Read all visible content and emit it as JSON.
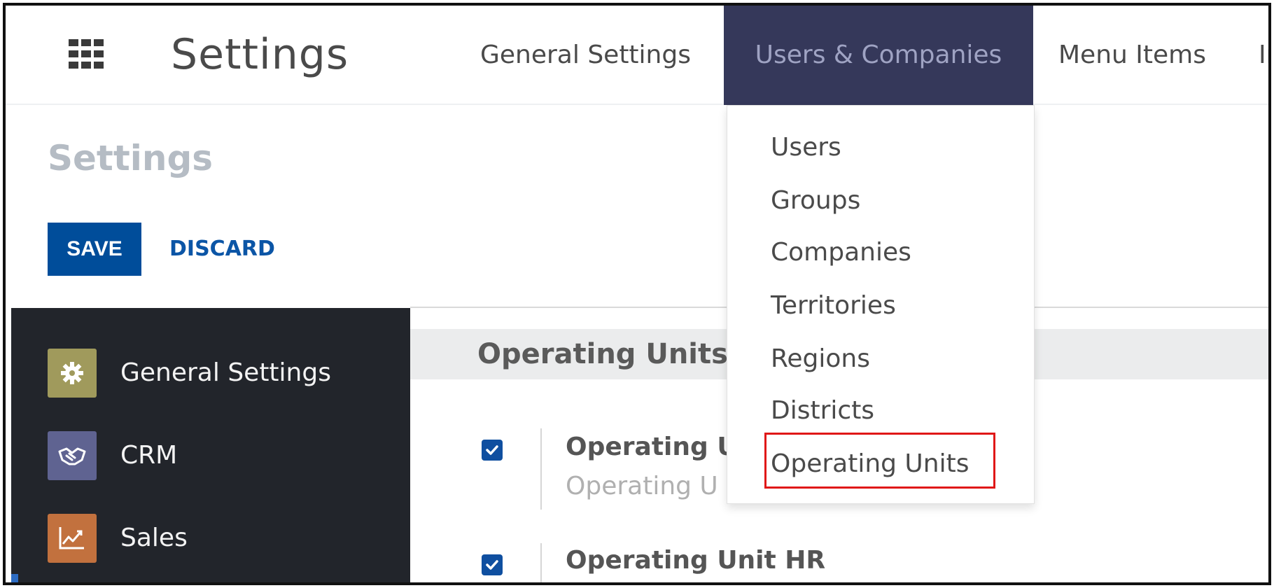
{
  "navbar": {
    "apps_icon": "grid-icon",
    "brand": "Settings",
    "tabs": [
      {
        "label": "General Settings",
        "active": false
      },
      {
        "label": "Users & Companies",
        "active": true
      },
      {
        "label": "Menu Items",
        "active": false
      },
      {
        "label": "In",
        "active": false
      }
    ]
  },
  "control_panel": {
    "title": "Settings",
    "save_label": "SAVE",
    "discard_label": "DISCARD"
  },
  "sidebar": {
    "items": [
      {
        "label": "General Settings",
        "icon": "gear-icon",
        "color": "#a09a5c"
      },
      {
        "label": "CRM",
        "icon": "handshake-icon",
        "color": "#5f6391"
      },
      {
        "label": "Sales",
        "icon": "chart-up-icon",
        "color": "#c2713e"
      }
    ]
  },
  "main": {
    "section_title": "Operating Units",
    "settings": [
      {
        "title": "Operating U",
        "description": "Operating U",
        "checked": true
      },
      {
        "title": "Operating Unit HR",
        "checked": true
      }
    ]
  },
  "dropdown": {
    "items": [
      {
        "label": "Users"
      },
      {
        "label": "Groups"
      },
      {
        "label": "Companies"
      },
      {
        "label": "Territories"
      },
      {
        "label": "Regions"
      },
      {
        "label": "Districts"
      },
      {
        "label": "Operating Units",
        "highlighted": true
      }
    ]
  },
  "colors": {
    "accent": "#004d9a",
    "active_tab_bg": "#35385a",
    "sidebar_bg": "#22252b",
    "highlight": "#e01818"
  }
}
